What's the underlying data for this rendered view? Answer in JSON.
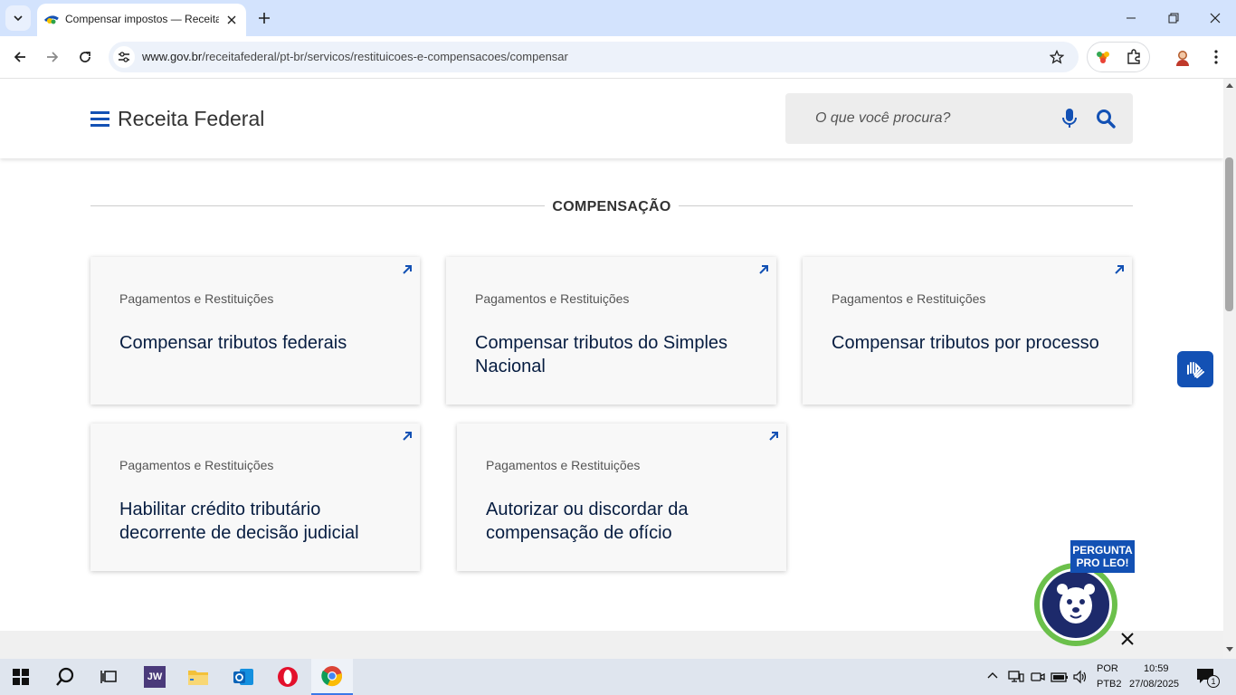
{
  "browser": {
    "tab": {
      "title": "Compensar impostos — Receita Federal"
    },
    "url": {
      "host": "www.gov.br",
      "path": "/receitafederal/pt-br/servicos/restituicoes-e-compensacoes/compensar"
    }
  },
  "header": {
    "site_title": "Receita Federal",
    "search_placeholder": "O que você procura?"
  },
  "section": {
    "title": "COMPENSAÇÃO"
  },
  "cards": [
    {
      "category": "Pagamentos e Restituições",
      "title": "Compensar tributos federais"
    },
    {
      "category": "Pagamentos e Restituições",
      "title": "Compensar tributos do Simples Nacional"
    },
    {
      "category": "Pagamentos e Restituições",
      "title": "Compensar tributos por processo"
    },
    {
      "category": "Pagamentos e Restituições",
      "title": "Habilitar crédito tributário decorrente de decisão judicial"
    },
    {
      "category": "Pagamentos e Restituições",
      "title": "Autorizar ou discordar da compensação de ofício"
    }
  ],
  "assistant": {
    "badge_line1": "PERGUNTA",
    "badge_line2": "PRO LEO!"
  },
  "taskbar": {
    "pinned": [
      "start-icon",
      "search-icon",
      "task-view-icon",
      "jw-icon",
      "file-explorer-icon",
      "outlook-icon",
      "opera-icon",
      "chrome-icon"
    ],
    "lang_line1": "POR",
    "lang_line2": "PTB2",
    "time": "10:59",
    "date": "27/08/2025",
    "notification_count": "1"
  },
  "colors": {
    "brand_blue": "#1351b4",
    "title_navy": "#071d41",
    "tabstrip": "#d3e3fd",
    "taskbar": "#dfe5ee"
  }
}
